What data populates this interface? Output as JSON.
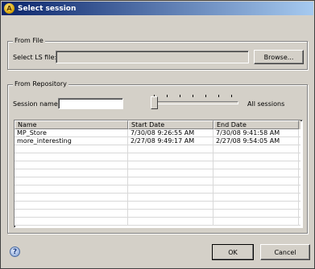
{
  "window": {
    "title": "Select session",
    "icon": "app-logo-icon"
  },
  "from_file": {
    "legend": "From File",
    "file_label": "Select LS file:",
    "file_value": "",
    "browse_label": "Browse..."
  },
  "from_repository": {
    "legend": "From Repository",
    "session_name_label": "Session name:",
    "session_name_value": "",
    "slider_value_label": "All sessions",
    "slider_position": 0,
    "columns": [
      "Name",
      "Start Date",
      "End Date"
    ],
    "rows": [
      [
        "MP_Store",
        "7/30/08 9:26:55 AM",
        "7/30/08 9:41:58 AM"
      ],
      [
        "more_interesting",
        "2/27/08 9:49:17 AM",
        "2/27/08 9:54:05 AM"
      ],
      [
        "",
        "",
        ""
      ],
      [
        "",
        "",
        ""
      ],
      [
        "",
        "",
        ""
      ],
      [
        "",
        "",
        ""
      ],
      [
        "",
        "",
        ""
      ],
      [
        "",
        "",
        ""
      ],
      [
        "",
        "",
        ""
      ],
      [
        "",
        "",
        ""
      ],
      [
        "",
        "",
        ""
      ],
      [
        "",
        "",
        ""
      ]
    ]
  },
  "footer": {
    "help_icon": "help-icon",
    "ok_label": "OK",
    "cancel_label": "Cancel"
  }
}
